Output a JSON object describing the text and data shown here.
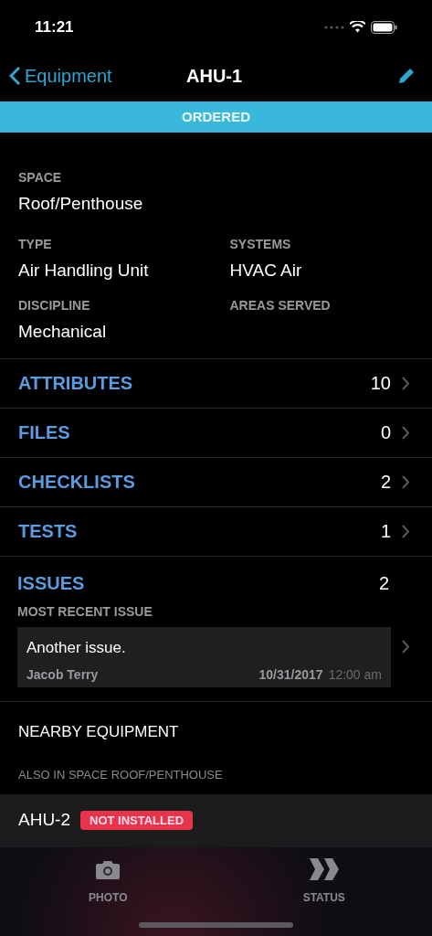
{
  "status_bar": {
    "time": "11:21"
  },
  "nav": {
    "back": "Equipment",
    "title": "AHU-1"
  },
  "status_banner": "ORDERED",
  "fields": [
    {
      "label": "SPACE",
      "value": "Roof/Penthouse"
    },
    {
      "label": "TYPE",
      "value": "Air Handling Unit"
    },
    {
      "label": "SYSTEMS",
      "value": "HVAC Air"
    },
    {
      "label": "DISCIPLINE",
      "value": "Mechanical"
    },
    {
      "label": "AREAS SERVED"
    }
  ],
  "sections": [
    {
      "label": "ATTRIBUTES",
      "count": "10"
    },
    {
      "label": "FILES",
      "count": "0"
    },
    {
      "label": "CHECKLISTS",
      "count": "2"
    },
    {
      "label": "TESTS",
      "count": "1"
    }
  ],
  "issues": {
    "label": "ISSUES",
    "count": "2",
    "recent_label": "MOST RECENT ISSUE",
    "recent": {
      "text": "Another issue.",
      "author": "Jacob Terry",
      "date": "10/31/2017",
      "time": "12:00 am"
    }
  },
  "nearby": {
    "title": "NEARBY EQUIPMENT",
    "subtitle": "ALSO IN SPACE ROOF/PENTHOUSE",
    "items": [
      {
        "name": "AHU-2",
        "badge": "NOT INSTALLED"
      }
    ]
  },
  "tab_bar": [
    {
      "kind": "photo",
      "label": "PHOTO"
    },
    {
      "kind": "status",
      "label": "STATUS"
    }
  ]
}
